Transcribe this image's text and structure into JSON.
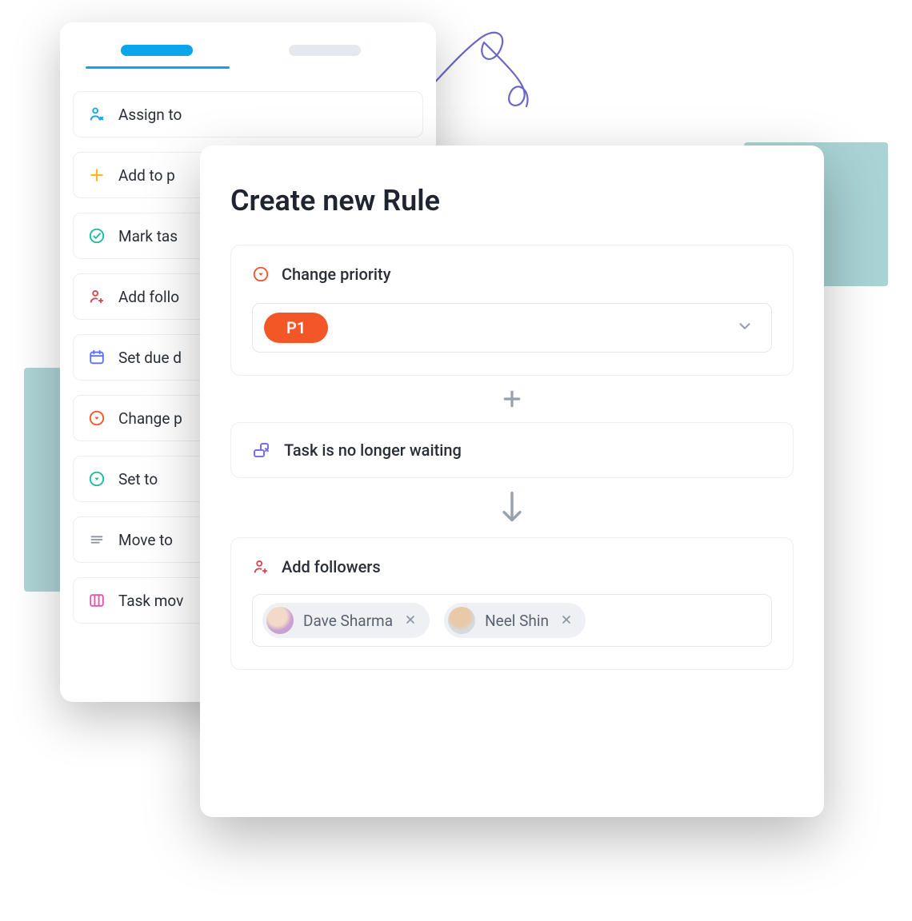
{
  "colors": {
    "accent": "#0ba5ec",
    "priorityBadge": "#f35627"
  },
  "backPanel": {
    "actions": [
      {
        "label": "Assign to",
        "icon": "assign-icon"
      },
      {
        "label": "Add to p",
        "icon": "plus-icon"
      },
      {
        "label": "Mark tas",
        "icon": "check-circle-icon"
      },
      {
        "label": "Add follo",
        "icon": "add-follower-icon"
      },
      {
        "label": "Set due d",
        "icon": "calendar-icon"
      },
      {
        "label": "Change p",
        "icon": "priority-icon"
      },
      {
        "label": "Set to",
        "icon": "set-to-icon"
      },
      {
        "label": "Move to",
        "icon": "move-icon"
      },
      {
        "label": "Task mov",
        "icon": "board-icon"
      }
    ]
  },
  "frontPanel": {
    "title": "Create new Rule",
    "changePriority": {
      "label": "Change priority",
      "selected": "P1"
    },
    "status": {
      "label": "Task is no longer waiting"
    },
    "addFollowers": {
      "label": "Add followers",
      "chips": [
        {
          "name": "Dave Sharma"
        },
        {
          "name": "Neel Shin"
        }
      ]
    }
  }
}
